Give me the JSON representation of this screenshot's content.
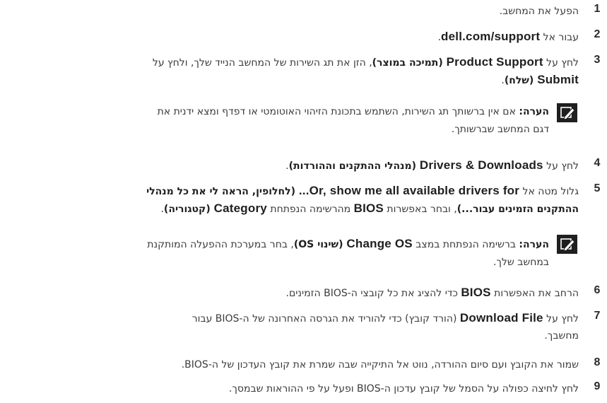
{
  "steps": [
    {
      "num": "1",
      "t": "הפעל את המחשב."
    },
    {
      "num": "2",
      "pre": "עבור אל ",
      "b": "dell.com/support",
      "post": "."
    },
    {
      "num": "3",
      "pre": "לחץ על ",
      "b1": "Product Support",
      "b1h": " (תמיכה במוצר)",
      "mid1": ", הזן את תג השירות של המחשב הנייד שלך, ולחץ על",
      "b2": "Submit",
      "b2h": " (שלח)",
      "post": "."
    },
    {
      "num": "4",
      "pre": "לחץ על ",
      "b": "Drivers & Downloads",
      "bh": " (מנהלי ההתקנים וההורדות)",
      "post": "."
    },
    {
      "num": "5",
      "pre": "גלול מטה אל ",
      "b1": "...Or, show me all available drivers for",
      "b1h": " (לחלופין, הראה לי את כל מנהלי",
      "b1h2": "ההתקנים הזמינים עבור...)",
      "mid": ", ובחר באפשרות ",
      "b2": "BIOS",
      "mid2": " מהרשימה הנפתחת ",
      "b3": "Category",
      "b3h": " (קטגוריה)",
      "post": "."
    },
    {
      "num": "6",
      "pre": "הרחב את האפשרות ",
      "b": "BIOS",
      "post": " כדי להציג את כל קובצי ה-BIOS הזמינים."
    },
    {
      "num": "7",
      "pre": "לחץ על ",
      "b": "Download File",
      "post": " (הורד קובץ) כדי להוריד את הגרסה האחרונה של ה-BIOS עבור",
      "post2": "מחשבך."
    },
    {
      "num": "8",
      "t": "שמור את הקובץ ועם סיום ההורדה, נווט אל התיקייה שבה שמרת את קובץ העדכון של ה-BIOS."
    },
    {
      "num": "9",
      "t": "לחץ לחיצה כפולה על הסמל של קובץ עדכון ה-BIOS ופעל על פי ההוראות שבמסך."
    }
  ],
  "notes": [
    {
      "label": "הערה:",
      "l1": " אם אין ברשותך תג השירות, השתמש בתכונת הזיהוי האוטומטי או דפדף ומצא ידנית את",
      "l2": "דגם המחשב שברשותך."
    },
    {
      "label": "הערה:",
      "pre": " ברשימה הנפתחת במצב ",
      "b": "Change OS",
      "bh": " (שינוי OS)",
      "post": ", בחר במערכת ההפעלה המותקנת",
      "l2": "במחשב שלך."
    }
  ],
  "icon": "note-pencil-icon"
}
